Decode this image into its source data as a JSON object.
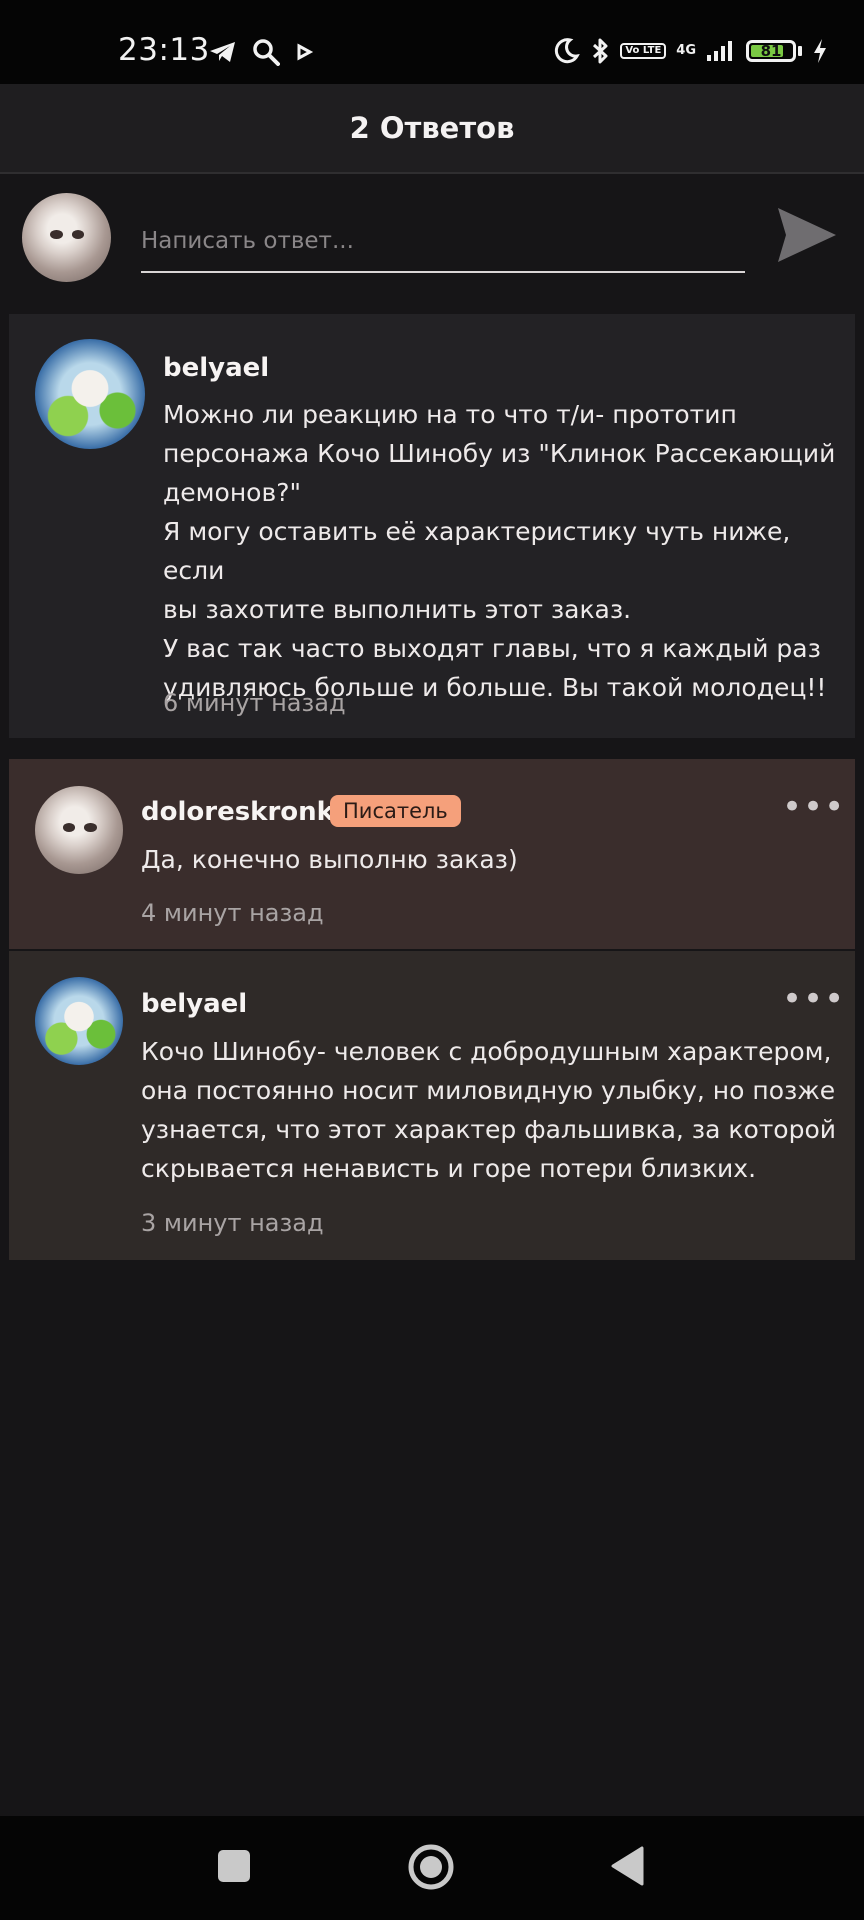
{
  "status_bar": {
    "time": "23:13",
    "icons": [
      "telegram-icon",
      "search-icon",
      "play-icon",
      "moon-icon",
      "bluetooth-icon",
      "volte-icon",
      "signal-icon"
    ],
    "lte_label": "Vo LTE",
    "network": "4G",
    "battery": "81",
    "battery_level": 0.81,
    "battery_color": "#7ac943"
  },
  "header": {
    "title": "2 Ответов"
  },
  "composer": {
    "placeholder": "Написать ответ..."
  },
  "comments": [
    {
      "author": "belyael",
      "text_lines": [
        "Можно ли реакцию на то что т/и- прототип",
        "персонажа Кочо Шинобу из \"Клинок Рассекающий",
        "демонов?\"",
        "Я могу оставить её характеристику чуть ниже, если",
        "вы захотите выполнить этот заказ.",
        "У вас так часто выходят главы, что я каждый раз",
        "удивляюсь больше и больше. Вы такой молодец!!"
      ],
      "time": "6 минут назад"
    },
    {
      "author": "doloreskronk",
      "badge": "Писатель",
      "text_lines": [
        "Да, конечно выполню заказ)"
      ],
      "time": "4 минут назад",
      "more": "•••"
    },
    {
      "author": "belyael",
      "text_lines": [
        "Кочо Шинобу- человек с добродушным характером,",
        "она постоянно носит миловидную улыбку, но позже",
        "узнается, что этот характер фальшивка, за которой",
        "скрывается ненависть и горе потери близких."
      ],
      "time": "3 минут назад",
      "more": "•••"
    }
  ],
  "colors": {
    "background": "#161517",
    "card": "#232225",
    "writer_card": "#3a2d2c",
    "reply_card": "#2f2a28",
    "badge": "#f5a07b"
  }
}
